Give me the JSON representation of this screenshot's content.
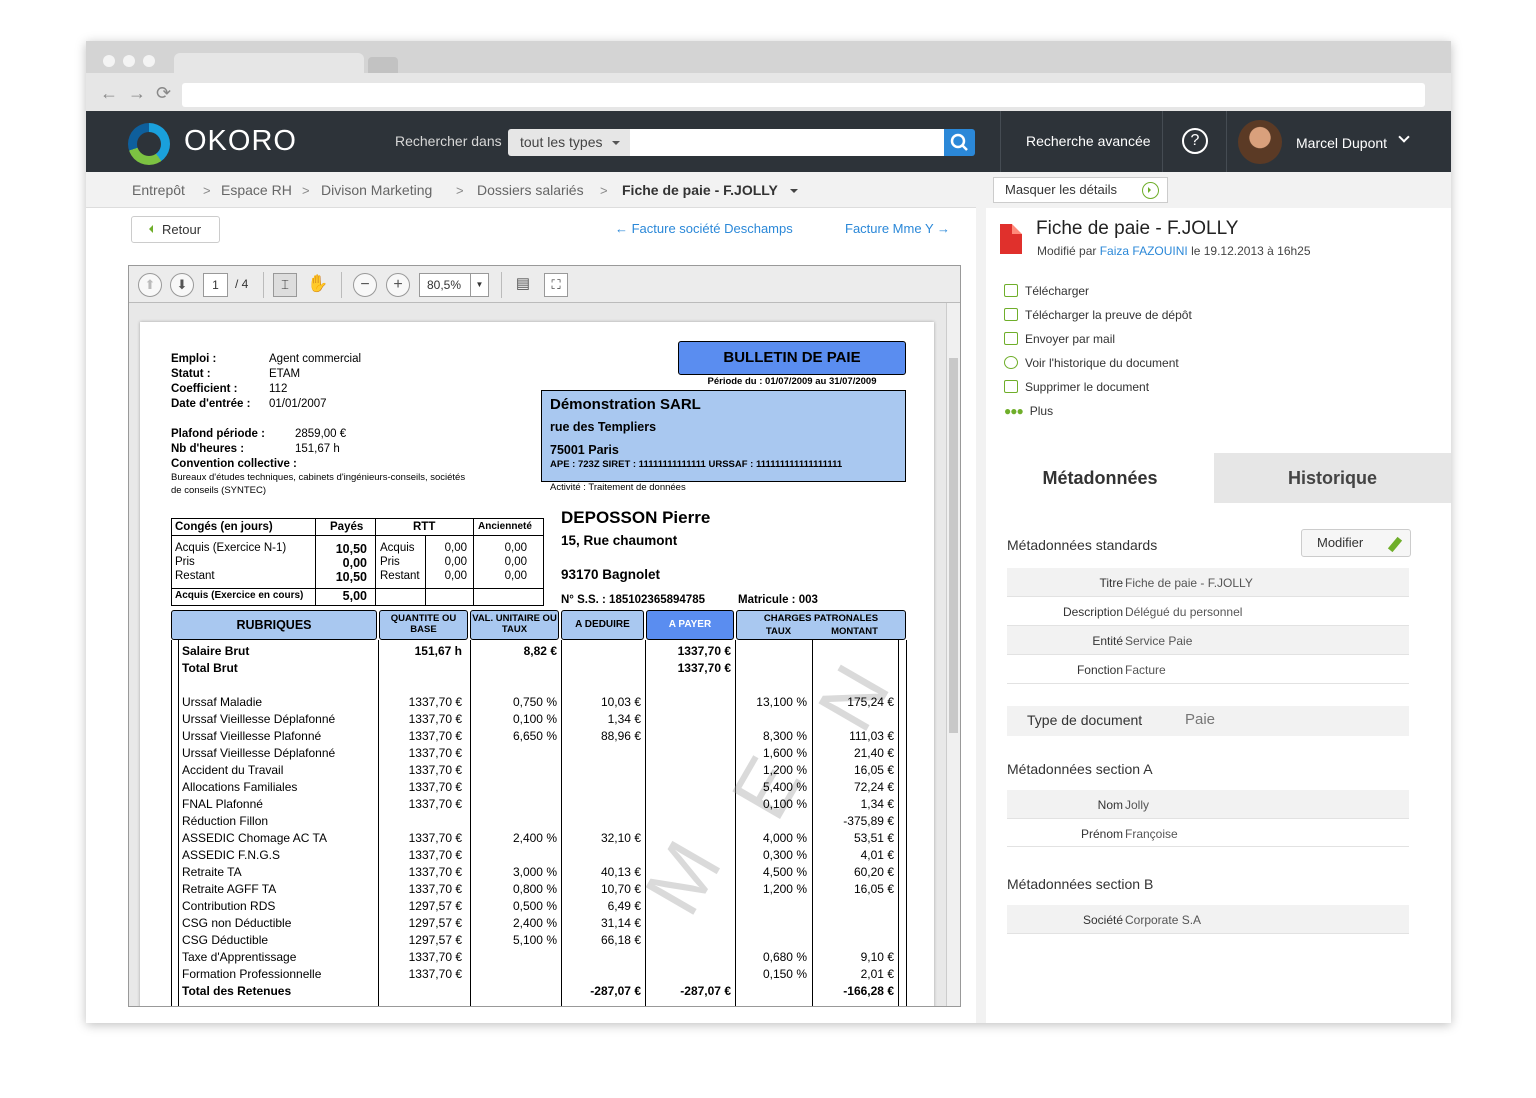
{
  "header": {
    "brand": "OKORO",
    "search_label": "Rechercher dans",
    "search_scope": "tout les types",
    "advanced": "Recherche avancée",
    "help": "?",
    "user": "Marcel Dupont"
  },
  "breadcrumb": [
    "Entrepôt",
    "Espace RH",
    "Divison Marketing",
    "Dossiers salariés",
    "Fiche de paie - F.JOLLY"
  ],
  "nav": {
    "back": "Retour",
    "prev": "← Facture société Deschamps",
    "next": "Facture Mme Y →"
  },
  "viewer": {
    "page": "1",
    "of": "/ 4",
    "zoom": "80,5%"
  },
  "doc": {
    "left_info": [
      [
        "Emploi :",
        "Agent commercial"
      ],
      [
        "Statut :",
        "ETAM"
      ],
      [
        "Coefficient :",
        "112"
      ],
      [
        "Date d'entrée :",
        "01/01/2007"
      ]
    ],
    "plafond": [
      [
        "Plafond période :",
        "2859,00 €"
      ],
      [
        "Nb d'heures :",
        "151,67 h"
      ]
    ],
    "convention_label": "Convention collective :",
    "convention_text": "Bureaux d'études techniques, cabinets d'ingénieurs-conseils, sociétés",
    "convention_text2": "de conseils (SYNTEC)",
    "title": "BULLETIN DE PAIE",
    "periode": "Période du : 01/07/2009 au 31/07/2009",
    "company": "Démonstration SARL",
    "street": "rue des Templiers",
    "city": "75001 Paris",
    "ids": "APE : 723Z   SIRET : 11111111111111   URSSAF : 111111111111111111",
    "activite": "Activité : Traitement de données",
    "employee": "DEPOSSON Pierre",
    "emp_street": "15, Rue chaumont",
    "emp_city": "93170 Bagnolet",
    "ss": "N° S.S. :  185102365894785",
    "matricule": "Matricule :  003",
    "conges": {
      "h1": "Congés (en jours)",
      "h2": "Payés",
      "h3": "RTT",
      "h4": "Ancienneté",
      "rows": [
        [
          "Acquis (Exercice N-1)",
          "10,50",
          "Acquis",
          "0,00",
          "0,00"
        ],
        [
          "Pris",
          "0,00",
          "Pris",
          "0,00",
          "0,00"
        ],
        [
          "Restant",
          "10,50",
          "Restant",
          "0,00",
          "0,00"
        ]
      ],
      "foot_label": "Acquis (Exercice en cours)",
      "foot_val": "5,00"
    },
    "cols": [
      "RUBRIQUES",
      "QUANTITE OU BASE",
      "VAL. UNITAIRE OU TAUX",
      "A DEDUIRE",
      "A PAYER",
      "CHARGES PATRONALES",
      "TAUX",
      "MONTANT"
    ],
    "rows": [
      [
        "Salaire Brut",
        "151,67 h",
        "8,82 €",
        "",
        "1337,70 €",
        "",
        ""
      ],
      [
        "Total Brut",
        "",
        "",
        "",
        "1337,70 €",
        "",
        ""
      ],
      [
        "",
        "",
        "",
        "",
        "",
        "",
        ""
      ],
      [
        "Urssaf Maladie",
        "1337,70 €",
        "0,750 %",
        "10,03 €",
        "",
        "13,100 %",
        "175,24 €"
      ],
      [
        "Urssaf Vieillesse Déplafonné",
        "1337,70 €",
        "0,100 %",
        "1,34 €",
        "",
        "",
        ""
      ],
      [
        "Urssaf Vieillesse Plafonné",
        "1337,70 €",
        "6,650 %",
        "88,96 €",
        "",
        "8,300 %",
        "111,03 €"
      ],
      [
        "Urssaf Vieillesse Déplafonné",
        "1337,70 €",
        "",
        "",
        "",
        "1,600 %",
        "21,40 €"
      ],
      [
        "Accident du Travail",
        "1337,70 €",
        "",
        "",
        "",
        "1,200 %",
        "16,05 €"
      ],
      [
        "Allocations Familiales",
        "1337,70 €",
        "",
        "",
        "",
        "5,400 %",
        "72,24 €"
      ],
      [
        "FNAL Plafonné",
        "1337,70 €",
        "",
        "",
        "",
        "0,100 %",
        "1,34 €"
      ],
      [
        "Réduction Fillon",
        "",
        "",
        "",
        "",
        "",
        "-375,89 €"
      ],
      [
        "ASSEDIC Chomage AC TA",
        "1337,70 €",
        "2,400 %",
        "32,10 €",
        "",
        "4,000 %",
        "53,51 €"
      ],
      [
        "ASSEDIC F.N.G.S",
        "1337,70 €",
        "",
        "",
        "",
        "0,300 %",
        "4,01 €"
      ],
      [
        "Retraite TA",
        "1337,70 €",
        "3,000 %",
        "40,13 €",
        "",
        "4,500 %",
        "60,20 €"
      ],
      [
        "Retraite AGFF TA",
        "1337,70 €",
        "0,800 %",
        "10,70 €",
        "",
        "1,200 %",
        "16,05 €"
      ],
      [
        "Contribution RDS",
        "1297,57 €",
        "0,500 %",
        "6,49 €",
        "",
        "",
        ""
      ],
      [
        "CSG non Déductible",
        "1297,57 €",
        "2,400 %",
        "31,14 €",
        "",
        "",
        ""
      ],
      [
        "CSG Déductible",
        "1297,57 €",
        "5,100 %",
        "66,18 €",
        "",
        "",
        ""
      ],
      [
        "Taxe d'Apprentissage",
        "1337,70 €",
        "",
        "",
        "",
        "0,680 %",
        "9,10 €"
      ],
      [
        "Formation Professionnelle",
        "1337,70 €",
        "",
        "",
        "",
        "0,150 %",
        "2,01 €"
      ],
      [
        "Total des Retenues",
        "",
        "",
        "-287,07 €",
        "-287,07 €",
        "",
        "-166,28 €"
      ]
    ]
  },
  "details": {
    "hide": "Masquer les détails",
    "title": "Fiche de paie - F.JOLLY",
    "mod_prefix": "Modifié par",
    "mod_user": "Faiza FAZOUINI",
    "mod_suffix": "le 19.12.2013 à 16h25",
    "actions": [
      "Télécharger",
      "Télécharger la preuve de dépôt",
      "Envoyer par mail",
      "Voir l'historique du document",
      "Supprimer le document",
      "Plus"
    ],
    "tab_meta": "Métadonnées",
    "tab_hist": "Historique",
    "std_title": "Métadonnées standards",
    "modify": "Modifier",
    "std": [
      [
        "Titre",
        "Fiche de paie - F.JOLLY"
      ],
      [
        "Description",
        "Délégué du personnel"
      ],
      [
        "Entité",
        "Service Paie"
      ],
      [
        "Fonction",
        "Facture"
      ]
    ],
    "type_label": "Type de document",
    "type_value": "Paie",
    "secA_title": "Métadonnées section A",
    "secA": [
      [
        "Nom",
        "Jolly"
      ],
      [
        "Prénom",
        "Françoise"
      ]
    ],
    "secB_title": "Métadonnées section B",
    "secB": [
      [
        "Société",
        "Corporate S.A"
      ]
    ]
  }
}
